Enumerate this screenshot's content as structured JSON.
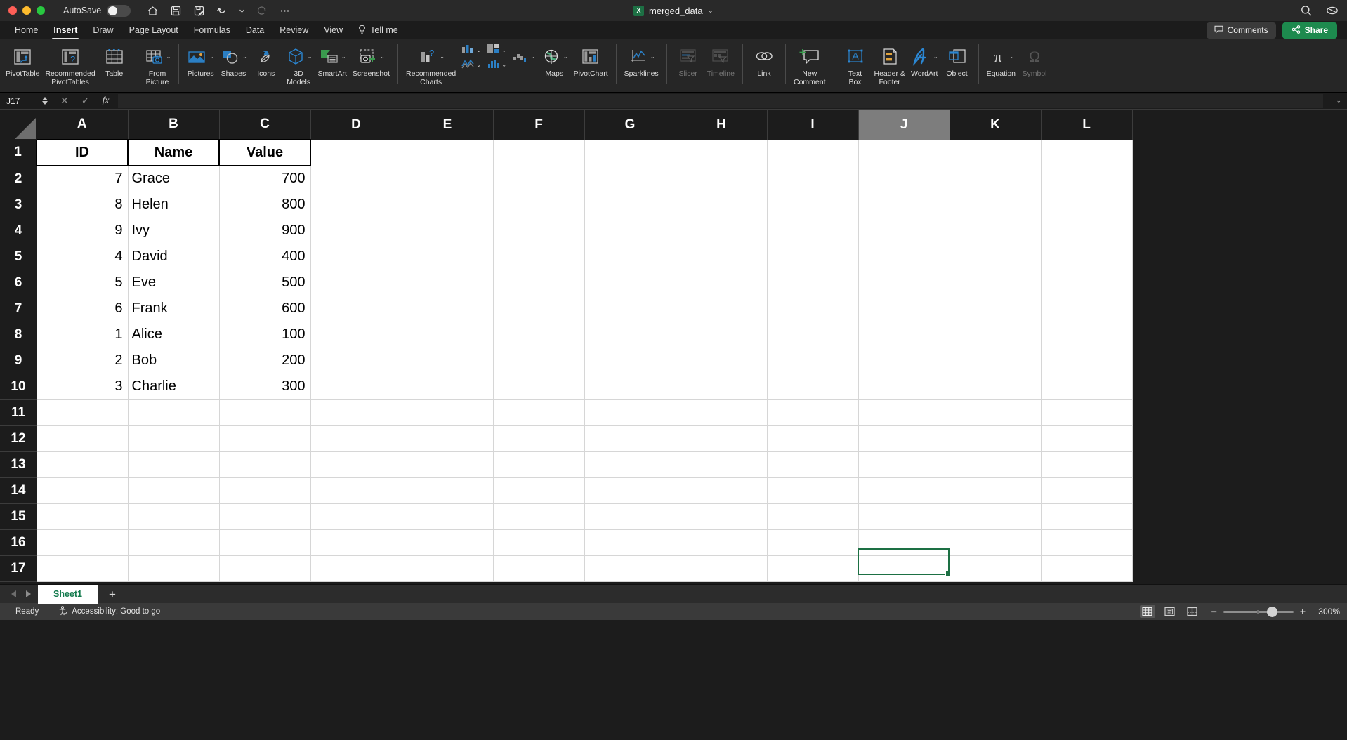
{
  "titlebar": {
    "autosave_label": "AutoSave",
    "autosave_state": "off",
    "quick_access": [
      "home-icon",
      "save-icon",
      "save-as-icon",
      "undo-icon",
      "undo-dropdown-icon",
      "redo-icon",
      "more-icon"
    ],
    "document_title": "merged_data",
    "document_title_caret": "⌄",
    "app_badge": "X",
    "search_icon": "search-icon",
    "ribbon_display_icon": "ribbon-display-icon"
  },
  "tabs": [
    {
      "label": "Home",
      "active": false
    },
    {
      "label": "Insert",
      "active": true
    },
    {
      "label": "Draw",
      "active": false
    },
    {
      "label": "Page Layout",
      "active": false
    },
    {
      "label": "Formulas",
      "active": false
    },
    {
      "label": "Data",
      "active": false
    },
    {
      "label": "Review",
      "active": false
    },
    {
      "label": "View",
      "active": false
    }
  ],
  "tellme": {
    "label": "Tell me",
    "icon": "lightbulb-icon"
  },
  "comments_button": {
    "label": "Comments",
    "icon": "comment-icon"
  },
  "share_button": {
    "label": "Share",
    "icon": "share-icon"
  },
  "ribbon": {
    "groups": [
      {
        "name": "tables",
        "items": [
          {
            "label": "PivotTable",
            "icon": "pivot-table-icon",
            "caret": false,
            "disabled": false
          },
          {
            "label": "Recommended\nPivotTables",
            "icon": "recommended-pivot-icon",
            "caret": false,
            "disabled": false
          },
          {
            "label": "Table",
            "icon": "table-icon",
            "caret": false,
            "disabled": false
          }
        ]
      },
      {
        "name": "picture",
        "items": [
          {
            "label": "From\nPicture",
            "icon": "from-picture-icon",
            "caret": true,
            "disabled": false
          }
        ]
      },
      {
        "name": "illustrations",
        "items": [
          {
            "label": "Pictures",
            "icon": "pictures-icon",
            "caret": true,
            "disabled": false
          },
          {
            "label": "Shapes",
            "icon": "shapes-icon",
            "caret": true,
            "disabled": false
          },
          {
            "label": "Icons",
            "icon": "icons-icon",
            "caret": false,
            "disabled": false
          },
          {
            "label": "3D\nModels",
            "icon": "3d-models-icon",
            "caret": true,
            "disabled": false
          },
          {
            "label": "SmartArt",
            "icon": "smartart-icon",
            "caret": true,
            "disabled": false
          },
          {
            "label": "Screenshot",
            "icon": "screenshot-icon",
            "caret": true,
            "disabled": false
          }
        ]
      },
      {
        "name": "charts",
        "items": [
          {
            "label": "Recommended\nCharts",
            "icon": "recommended-charts-icon",
            "caret": true,
            "disabled": false
          },
          {
            "label": "",
            "icon": "column-chart-icon",
            "caret": true,
            "disabled": false
          },
          {
            "label": "",
            "icon": "hierarchy-chart-icon",
            "caret": true,
            "disabled": false
          },
          {
            "label": "",
            "icon": "waterfall-chart-icon",
            "caret": true,
            "disabled": false
          },
          {
            "label": "",
            "icon": "line-chart-icon",
            "caret": true,
            "disabled": false
          },
          {
            "label": "",
            "icon": "statistic-chart-icon",
            "caret": true,
            "disabled": false
          },
          {
            "label": "",
            "icon": "scatter-chart-icon",
            "caret": true,
            "disabled": false
          },
          {
            "label": "Maps",
            "icon": "maps-icon",
            "caret": true,
            "disabled": false
          },
          {
            "label": "PivotChart",
            "icon": "pivotchart-icon",
            "caret": false,
            "disabled": false
          }
        ]
      },
      {
        "name": "sparklines",
        "items": [
          {
            "label": "Sparklines",
            "icon": "sparklines-icon",
            "caret": true,
            "disabled": false
          }
        ]
      },
      {
        "name": "filters",
        "items": [
          {
            "label": "Slicer",
            "icon": "slicer-icon",
            "caret": false,
            "disabled": true
          },
          {
            "label": "Timeline",
            "icon": "timeline-icon",
            "caret": false,
            "disabled": true
          }
        ]
      },
      {
        "name": "links",
        "items": [
          {
            "label": "Link",
            "icon": "link-icon",
            "caret": false,
            "disabled": false
          }
        ]
      },
      {
        "name": "comments",
        "items": [
          {
            "label": "New\nComment",
            "icon": "new-comment-icon",
            "caret": false,
            "disabled": false
          }
        ]
      },
      {
        "name": "text",
        "items": [
          {
            "label": "Text\nBox",
            "icon": "text-box-icon",
            "caret": false,
            "disabled": false
          },
          {
            "label": "Header &\nFooter",
            "icon": "header-footer-icon",
            "caret": false,
            "disabled": false
          },
          {
            "label": "WordArt",
            "icon": "wordart-icon",
            "caret": true,
            "disabled": false
          },
          {
            "label": "Object",
            "icon": "object-icon",
            "caret": false,
            "disabled": false
          }
        ]
      },
      {
        "name": "symbols",
        "items": [
          {
            "label": "Equation",
            "icon": "equation-icon",
            "caret": true,
            "disabled": false
          },
          {
            "label": "Symbol",
            "icon": "symbol-icon",
            "caret": false,
            "disabled": true
          }
        ]
      }
    ]
  },
  "formula_bar": {
    "name_box_value": "J17",
    "cancel_icon": "cancel-icon",
    "confirm_icon": "confirm-icon",
    "fx_icon": "fx-icon",
    "formula_value": "",
    "formula_placeholder": ""
  },
  "grid": {
    "columns": [
      "A",
      "B",
      "C",
      "D",
      "E",
      "F",
      "G",
      "H",
      "I",
      "J",
      "K",
      "L"
    ],
    "selected_column": "J",
    "selected_cell": "J17",
    "rows": [
      {
        "num": "1",
        "cells": [
          "ID",
          "Name",
          "Value",
          "",
          "",
          "",
          "",
          "",
          "",
          "",
          "",
          ""
        ],
        "header": true
      },
      {
        "num": "2",
        "cells": [
          "7",
          "Grace",
          "700",
          "",
          "",
          "",
          "",
          "",
          "",
          "",
          "",
          ""
        ],
        "header": false
      },
      {
        "num": "3",
        "cells": [
          "8",
          "Helen",
          "800",
          "",
          "",
          "",
          "",
          "",
          "",
          "",
          "",
          ""
        ],
        "header": false
      },
      {
        "num": "4",
        "cells": [
          "9",
          "Ivy",
          "900",
          "",
          "",
          "",
          "",
          "",
          "",
          "",
          "",
          ""
        ],
        "header": false
      },
      {
        "num": "5",
        "cells": [
          "4",
          "David",
          "400",
          "",
          "",
          "",
          "",
          "",
          "",
          "",
          "",
          ""
        ],
        "header": false
      },
      {
        "num": "6",
        "cells": [
          "5",
          "Eve",
          "500",
          "",
          "",
          "",
          "",
          "",
          "",
          "",
          "",
          ""
        ],
        "header": false
      },
      {
        "num": "7",
        "cells": [
          "6",
          "Frank",
          "600",
          "",
          "",
          "",
          "",
          "",
          "",
          "",
          "",
          ""
        ],
        "header": false
      },
      {
        "num": "8",
        "cells": [
          "1",
          "Alice",
          "100",
          "",
          "",
          "",
          "",
          "",
          "",
          "",
          "",
          ""
        ],
        "header": false
      },
      {
        "num": "9",
        "cells": [
          "2",
          "Bob",
          "200",
          "",
          "",
          "",
          "",
          "",
          "",
          "",
          "",
          ""
        ],
        "header": false
      },
      {
        "num": "10",
        "cells": [
          "3",
          "Charlie",
          "300",
          "",
          "",
          "",
          "",
          "",
          "",
          "",
          "",
          ""
        ],
        "header": false
      },
      {
        "num": "11",
        "cells": [
          "",
          "",
          "",
          "",
          "",
          "",
          "",
          "",
          "",
          "",
          "",
          ""
        ],
        "header": false
      },
      {
        "num": "12",
        "cells": [
          "",
          "",
          "",
          "",
          "",
          "",
          "",
          "",
          "",
          "",
          "",
          ""
        ],
        "header": false
      },
      {
        "num": "13",
        "cells": [
          "",
          "",
          "",
          "",
          "",
          "",
          "",
          "",
          "",
          "",
          "",
          ""
        ],
        "header": false
      },
      {
        "num": "14",
        "cells": [
          "",
          "",
          "",
          "",
          "",
          "",
          "",
          "",
          "",
          "",
          "",
          ""
        ],
        "header": false
      },
      {
        "num": "15",
        "cells": [
          "",
          "",
          "",
          "",
          "",
          "",
          "",
          "",
          "",
          "",
          "",
          ""
        ],
        "header": false
      },
      {
        "num": "16",
        "cells": [
          "",
          "",
          "",
          "",
          "",
          "",
          "",
          "",
          "",
          "",
          "",
          ""
        ],
        "header": false
      },
      {
        "num": "17",
        "cells": [
          "",
          "",
          "",
          "",
          "",
          "",
          "",
          "",
          "",
          "",
          "",
          ""
        ],
        "header": false
      }
    ]
  },
  "sheet_tabs": {
    "prev_icon": "prev-sheet-icon",
    "next_icon": "next-sheet-icon",
    "tabs": [
      {
        "label": "Sheet1",
        "active": true
      }
    ],
    "add_label": "+"
  },
  "status_bar": {
    "status_text": "Ready",
    "accessibility_icon": "accessibility-icon",
    "accessibility_text": "Accessibility: Good to go",
    "view_buttons": [
      {
        "name": "normal-view",
        "active": true
      },
      {
        "name": "page-layout-view",
        "active": false
      },
      {
        "name": "page-break-view",
        "active": false
      }
    ],
    "zoom_out_label": "−",
    "zoom_in_label": "+",
    "zoom_level": "300%"
  },
  "colors": {
    "accent_green": "#1d8a4e",
    "sheet_tab_text": "#137a4d",
    "selection": "#1d7044",
    "ribbon_bg": "#262626",
    "grid_bg": "#ffffff"
  }
}
